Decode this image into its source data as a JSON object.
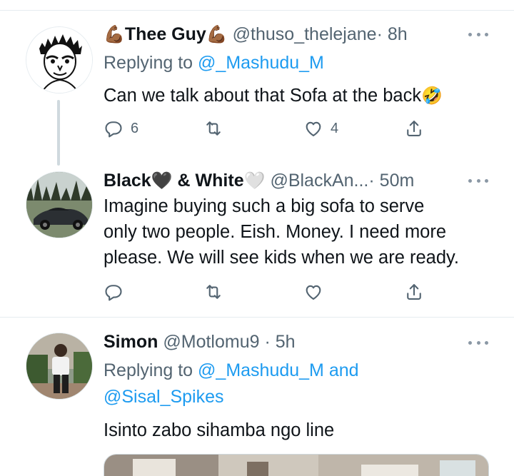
{
  "tweets": [
    {
      "name_prefix_emoji": "💪🏾",
      "name": "Thee Guy",
      "name_suffix_emoji": "💪🏾",
      "handle": "@thuso_thelejane",
      "time": "· 8h",
      "replying_prefix": "Replying to",
      "replying_to": "@_Mashudu_M",
      "text": "Can we talk about that Sofa at the back",
      "text_emoji": "🤣",
      "reply_count": "6",
      "retweet_count": "",
      "like_count": "4"
    },
    {
      "name": "Black",
      "name_emoji_1": "🖤",
      "name_mid": " & White",
      "name_emoji_2": "🤍",
      "handle": "@BlackAn...",
      "time": "· 50m",
      "text_lines": [
        "Imagine buying such a big sofa to serve",
        "only two people. Eish. Money. I need more",
        "please. We will see kids when we are ready."
      ],
      "reply_count": "",
      "retweet_count": "",
      "like_count": ""
    },
    {
      "name": "Simon",
      "handle": "@Motlomu9",
      "time": "· 5h",
      "replying_prefix": "Replying to",
      "replying_to_1": "@_Mashudu_M",
      "replying_and": "and",
      "replying_to_2": "@Sisal_Spikes",
      "text": "Isinto zabo sihamba ngo line"
    }
  ],
  "icons": {
    "reply": "reply-icon",
    "retweet": "retweet-icon",
    "like": "heart-icon",
    "share": "share-icon",
    "more": "more-icon"
  },
  "colors": {
    "link": "#1d9bf0",
    "secondary": "#536471",
    "divider": "#e6ecf0",
    "thread_line": "#cfd9de"
  }
}
